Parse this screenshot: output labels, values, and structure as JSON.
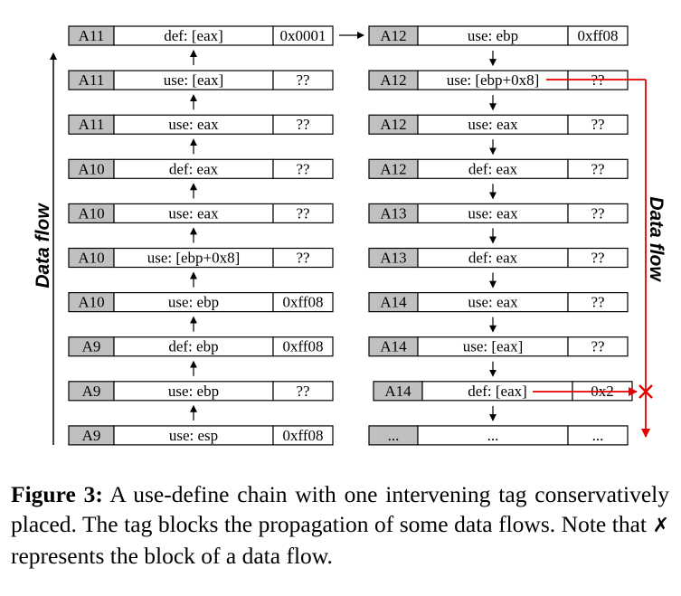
{
  "colors": {
    "label_fill": "#c0c0c0",
    "block": "#e60000",
    "stroke": "#000000"
  },
  "left_chain": [
    {
      "label": "A11",
      "op": "def: [eax]",
      "value": "0x0001"
    },
    {
      "label": "A11",
      "op": "use: [eax]",
      "value": "??"
    },
    {
      "label": "A11",
      "op": "use: eax",
      "value": "??"
    },
    {
      "label": "A10",
      "op": "def: eax",
      "value": "??"
    },
    {
      "label": "A10",
      "op": "use: eax",
      "value": "??"
    },
    {
      "label": "A10",
      "op": "use: [ebp+0x8]",
      "value": "??"
    },
    {
      "label": "A10",
      "op": "use: ebp",
      "value": "0xff08"
    },
    {
      "label": "A9",
      "op": "def: ebp",
      "value": "0xff08"
    },
    {
      "label": "A9",
      "op": "use: ebp",
      "value": "??"
    },
    {
      "label": "A9",
      "op": "use: esp",
      "value": "0xff08"
    }
  ],
  "right_chain": [
    {
      "label": "A12",
      "op": "use: ebp",
      "value": "0xff08"
    },
    {
      "label": "A12",
      "op": "use: [ebp+0x8]",
      "value": "??"
    },
    {
      "label": "A12",
      "op": "use: eax",
      "value": "??"
    },
    {
      "label": "A12",
      "op": "def: eax",
      "value": "??"
    },
    {
      "label": "A13",
      "op": "use: eax",
      "value": "??"
    },
    {
      "label": "A13",
      "op": "def: eax",
      "value": "??"
    },
    {
      "label": "A14",
      "op": "use: eax",
      "value": "??"
    },
    {
      "label": "A14",
      "op": "use: [eax]",
      "value": "??"
    },
    {
      "label": "A14",
      "op": "def: [eax]",
      "value": "0x2"
    },
    {
      "label": "...",
      "op": "...",
      "value": "..."
    }
  ],
  "axis_labels": {
    "left": "Data flow",
    "right": "Data flow"
  },
  "caption": {
    "label": "Figure 3:",
    "text_before": "A use-define chain with one intervening tag conservatively placed. The tag blocks the propagation of some data flows. Note that",
    "symbol": "✗",
    "text_after": "represents the block of a data flow."
  }
}
